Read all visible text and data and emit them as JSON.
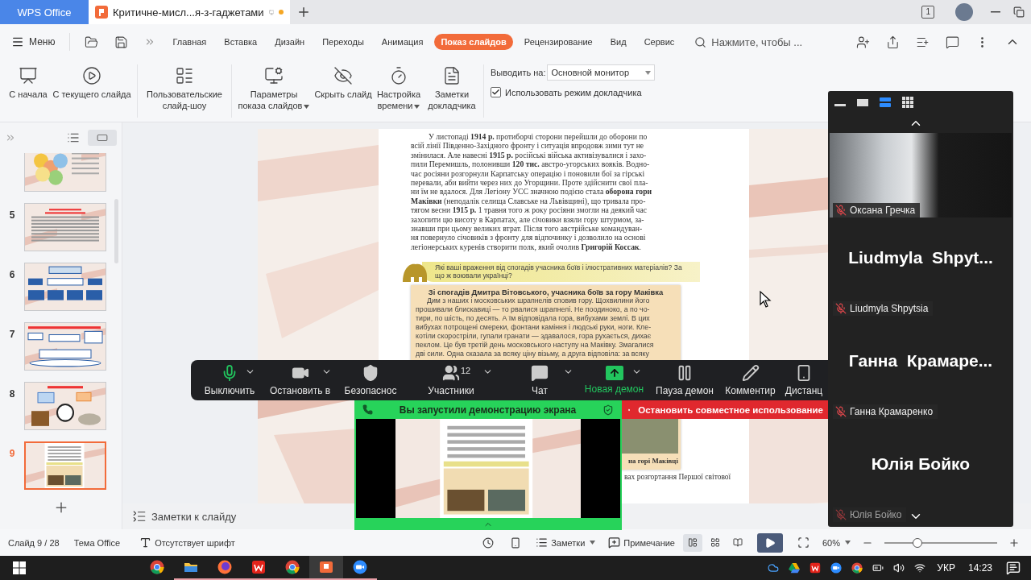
{
  "title_bar": {
    "app_tab": "WPS Office",
    "doc_tab": "Критичне-мисл...я-з-гаджетами",
    "unsaved": true,
    "window_count": "1"
  },
  "menu": {
    "label": "Меню"
  },
  "tabs": [
    {
      "label": "Главная",
      "selected": false
    },
    {
      "label": "Вставка",
      "selected": false
    },
    {
      "label": "Дизайн",
      "selected": false
    },
    {
      "label": "Переходы",
      "selected": false
    },
    {
      "label": "Анимация",
      "selected": false
    },
    {
      "label": "Показ слайдов",
      "selected": true
    },
    {
      "label": "Рецензирование",
      "selected": false
    },
    {
      "label": "Вид",
      "selected": false
    },
    {
      "label": "Сервис",
      "selected": false
    }
  ],
  "search": {
    "placeholder": "Нажмите, чтобы ..."
  },
  "ribbon": {
    "groups": [
      [
        {
          "kind": "from-start",
          "label": "С начала",
          "dropdown": false
        },
        {
          "kind": "from-current",
          "label": "С текущего слайда",
          "dropdown": false
        }
      ],
      [
        {
          "kind": "custom-show",
          "label": "Пользовательские слайд-шоу",
          "dropdown": false
        }
      ],
      [
        {
          "kind": "settings",
          "label": "Параметры показа слайдов",
          "dropdown": true
        },
        {
          "kind": "hide",
          "label": "Скрыть слайд",
          "dropdown": false
        },
        {
          "kind": "timing",
          "label": "Настройка времени",
          "dropdown": true
        },
        {
          "kind": "notes",
          "label": "Заметки докладчика",
          "dropdown": false
        }
      ]
    ],
    "output_label": "Выводить на:",
    "output_value": "Основной монитор",
    "presenter_mode": {
      "label": "Использовать режим докладчика",
      "checked": true
    }
  },
  "thumbnails": [
    {
      "kind": "circles",
      "selected": false
    },
    {
      "number": "5",
      "kind": "text",
      "selected": false
    },
    {
      "number": "6",
      "kind": "flowchart",
      "selected": false
    },
    {
      "number": "7",
      "kind": "diagram",
      "selected": false
    },
    {
      "number": "8",
      "kind": "collage",
      "selected": false
    },
    {
      "number": "9",
      "kind": "page",
      "selected": true
    }
  ],
  "slide": {
    "paragraph": "У листопаді **1914 р.** протиборчі сторони перейшли до оборони по\nвсій лінії Південно-Західного фронту і ситуація впродовж зими тут не\nзмінилася. Але навесні **1915 р.** російські війська активізувалися і захо-\nпили Перемишль, полонивши **120 тис.** австро-угорських вояків. Водно-\nчас росіяни розгорнули Карпатську операцію і поновили бої за гірські\nперевали, аби вийти через них до Угорщини. Проте здійснити свої пла-\nни їм не вдалося. Для Легіону УСС значною подією стала **оборона гори**\n**Маківки** (неподалік селища Славське на Львівщині), що тривала про-\nтягом весни **1915 р.** 1 травня того ж року росіяни змогли на деякий час\nзахопити цю висоту в Карпатах, але січовики взяли гору штурмом, за-\nзнавши при цьому великих втрат. Після того австрійське командуван-\nня повернуло січовиків з фронту для відпочинку і дозволило на основі\nлегіонерських куренів створити полк, який очолив **Григорій Коссак**.",
    "question": "Які ваші враження від спогадів учасника боїв і ілюстративних матеріалів? За\nщо ж воювали українці?",
    "quote_title": "Зі спогадів Дмитра Вітовського, учасника боїв за гору Маківка",
    "quote_text": "Дим з наших і московських шрапнелів сповив гору. Щохвилини його\nпрошивали блискавиці — то рвалися шрапнелі. Не поодиноко, а по чо-\nтири, по шість, по десять. А їм відповідала гора, вибухами землі. В цих\nвибухах потрощені смереки, фонтани каміння і людські руки, ноги. Кле-\nкотіли скоростріли, гупали гранати — здавалося, гора рухається, дихає\nпеклом. Це був третій день московського наступу на Маківку. Змагалися\nдві сили. Одна сказала за всяку ціну візьму, а друга відповіла: за всяку",
    "caption": "на горі Маківці",
    "bottom_line": "вах розгортання Першої світової"
  },
  "notes_bar": {
    "label": "Заметки к слайду"
  },
  "meeting_toolbar": {
    "items": [
      {
        "kind": "mic",
        "label": "Выключить",
        "menu": true,
        "highlighted": false
      },
      {
        "kind": "video",
        "label": "Остановить в",
        "menu": true,
        "highlighted": false
      },
      {
        "kind": "security",
        "label": "Безопаснос",
        "menu": false,
        "highlighted": false
      },
      {
        "kind": "participants",
        "label": "Участники",
        "count": "12",
        "menu": true,
        "highlighted": false
      },
      {
        "kind": "chat",
        "label": "Чат",
        "menu": true,
        "highlighted": false
      },
      {
        "kind": "share",
        "label": "Новая демон",
        "menu": true,
        "highlighted": true
      },
      {
        "kind": "pause",
        "label": "Пауза демон",
        "menu": false,
        "highlighted": false
      },
      {
        "kind": "annotate",
        "label": "Комментир",
        "menu": false,
        "highlighted": false
      },
      {
        "kind": "remote",
        "label": "Дистанц",
        "menu": false,
        "highlighted": false
      }
    ]
  },
  "share_banner": {
    "title": "Вы запустили демонстрацию экрана",
    "stop": "Остановить совместное использование"
  },
  "participants": {
    "views": [
      {
        "kind": "minimize",
        "selected": false
      },
      {
        "kind": "single",
        "selected": false
      },
      {
        "kind": "speaker",
        "selected": true
      },
      {
        "kind": "grid",
        "selected": false
      }
    ],
    "tiles": [
      {
        "kind": "video",
        "name": "Оксана Гречка",
        "muted": true,
        "dimmed": false
      },
      {
        "kind": "name",
        "display": "Liudmyla  Shpyt...",
        "name": "Liudmyla Shpytsia",
        "muted": true,
        "dimmed": false
      },
      {
        "kind": "name",
        "display": "Ганна  Крамаре...",
        "name": "Ганна Крамаренко",
        "muted": true,
        "dimmed": false
      },
      {
        "kind": "name",
        "display": "Юлія Бойко",
        "name": "Юлія Бойко",
        "muted": true,
        "dimmed": true
      }
    ]
  },
  "status_bar": {
    "slide": "Слайд 9 / 28",
    "theme": "Тема Office",
    "font": "Отсутствует шрифт",
    "notes": "Заметки",
    "comment": "Примечание",
    "views": [
      {
        "kind": "normal",
        "selected": true
      },
      {
        "kind": "sorter",
        "selected": false
      },
      {
        "kind": "reading",
        "selected": false
      }
    ],
    "zoom": "60%",
    "zoom_slider": {
      "level": 0.25
    }
  },
  "taskbar": {
    "apps": [
      {
        "kind": "browser",
        "running": false,
        "selected": false
      },
      {
        "kind": "folder",
        "running": true,
        "selected": false
      },
      {
        "kind": "fox",
        "running": true,
        "selected": false
      },
      {
        "kind": "office",
        "running": true,
        "selected": false
      },
      {
        "kind": "browser",
        "running": true,
        "selected": false
      },
      {
        "kind": "presentation",
        "running": true,
        "selected": true
      },
      {
        "kind": "meeting",
        "running": true,
        "selected": false
      }
    ],
    "tray": [
      {
        "kind": "cloud"
      },
      {
        "kind": "drive"
      },
      {
        "kind": "office"
      },
      {
        "kind": "meeting"
      },
      {
        "kind": "browser"
      },
      {
        "kind": "battery"
      },
      {
        "kind": "speaker"
      },
      {
        "kind": "wifi"
      }
    ],
    "language": "УКР",
    "time": "14:23"
  }
}
